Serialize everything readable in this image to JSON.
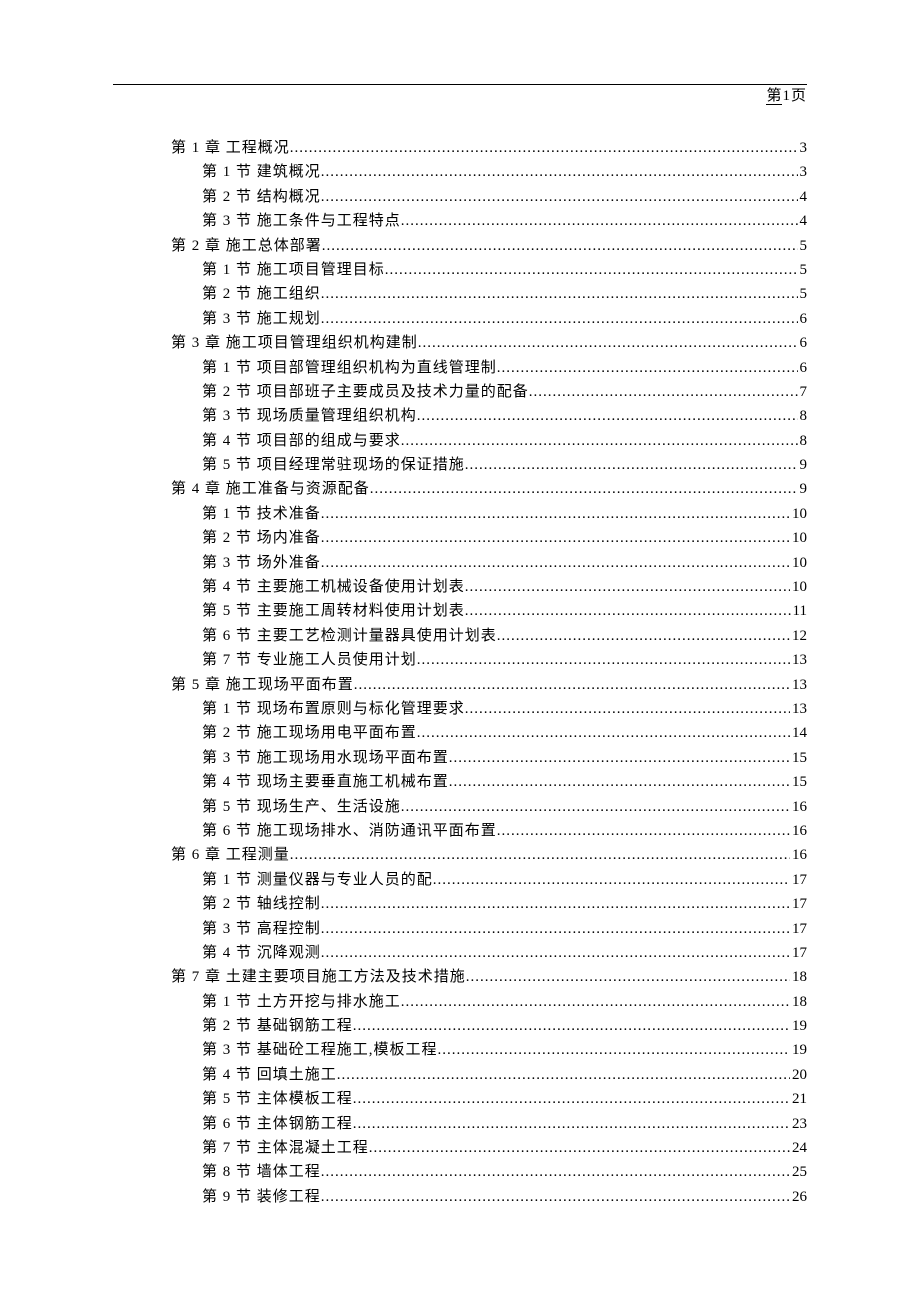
{
  "header": {
    "page_prefix": "第",
    "page_num": "1",
    "page_suffix": "页"
  },
  "toc": [
    {
      "level": 1,
      "title": "第 1 章  工程概况",
      "page": "3"
    },
    {
      "level": 2,
      "title": "第 1 节  建筑概况",
      "page": "3"
    },
    {
      "level": 2,
      "title": "第 2 节  结构概况",
      "page": "4"
    },
    {
      "level": 2,
      "title": "第 3 节  施工条件与工程特点",
      "page": "4"
    },
    {
      "level": 1,
      "title": "第 2 章  施工总体部署",
      "page": "5"
    },
    {
      "level": 2,
      "title": "第 1 节  施工项目管理目标",
      "page": "5"
    },
    {
      "level": 2,
      "title": "第 2 节  施工组织",
      "page": "5"
    },
    {
      "level": 2,
      "title": "第 3 节  施工规划",
      "page": "6"
    },
    {
      "level": 1,
      "title": "第 3 章  施工项目管理组织机构建制",
      "page": "6"
    },
    {
      "level": 2,
      "title": "第 1 节  项目部管理组织机构为直线管理制",
      "page": "6"
    },
    {
      "level": 2,
      "title": "第 2 节  项目部班子主要成员及技术力量的配备",
      "page": "7"
    },
    {
      "level": 2,
      "title": "第 3 节  现场质量管理组织机构",
      "page": "8"
    },
    {
      "level": 2,
      "title": "第 4 节  项目部的组成与要求",
      "page": "8"
    },
    {
      "level": 2,
      "title": "第 5 节  项目经理常驻现场的保证措施",
      "page": "9"
    },
    {
      "level": 1,
      "title": "第 4 章  施工准备与资源配备",
      "page": "9"
    },
    {
      "level": 2,
      "title": "第 1 节  技术准备",
      "page": "10"
    },
    {
      "level": 2,
      "title": "第 2 节  场内准备",
      "page": "10"
    },
    {
      "level": 2,
      "title": "第 3 节  场外准备",
      "page": "10"
    },
    {
      "level": 2,
      "title": "第 4 节  主要施工机械设备使用计划表",
      "page": "10"
    },
    {
      "level": 2,
      "title": "第 5 节  主要施工周转材料使用计划表",
      "page": "11"
    },
    {
      "level": 2,
      "title": "第 6 节  主要工艺检测计量器具使用计划表",
      "page": "12"
    },
    {
      "level": 2,
      "title": "第 7 节  专业施工人员使用计划",
      "page": "13"
    },
    {
      "level": 1,
      "title": "第 5 章  施工现场平面布置",
      "page": "13"
    },
    {
      "level": 2,
      "title": "第 1 节  现场布置原则与标化管理要求",
      "page": "13"
    },
    {
      "level": 2,
      "title": "第 2 节  施工现场用电平面布置",
      "page": "14"
    },
    {
      "level": 2,
      "title": "第 3 节  施工现场用水现场平面布置",
      "page": "15"
    },
    {
      "level": 2,
      "title": "第 4 节  现场主要垂直施工机械布置",
      "page": "15"
    },
    {
      "level": 2,
      "title": "第 5 节  现场生产、生活设施",
      "page": "16"
    },
    {
      "level": 2,
      "title": "第 6 节  施工现场排水、消防通讯平面布置",
      "page": "16"
    },
    {
      "level": 1,
      "title": "第 6 章  工程测量",
      "page": "16"
    },
    {
      "level": 2,
      "title": "第 1 节  测量仪器与专业人员的配",
      "page": "17"
    },
    {
      "level": 2,
      "title": "第 2 节  轴线控制",
      "page": "17"
    },
    {
      "level": 2,
      "title": "第 3 节  高程控制",
      "page": "17"
    },
    {
      "level": 2,
      "title": "第 4 节  沉降观测",
      "page": "17"
    },
    {
      "level": 1,
      "title": "第 7 章  土建主要项目施工方法及技术措施",
      "page": "18"
    },
    {
      "level": 2,
      "title": "第 1 节  土方开挖与排水施工",
      "page": "18"
    },
    {
      "level": 2,
      "title": "第 2 节  基础钢筋工程",
      "page": "19"
    },
    {
      "level": 2,
      "title": "第 3 节  基础砼工程施工,模板工程",
      "page": "19"
    },
    {
      "level": 2,
      "title": "第 4 节  回填土施工",
      "page": "20"
    },
    {
      "level": 2,
      "title": "第 5 节  主体模板工程",
      "page": "21"
    },
    {
      "level": 2,
      "title": "第 6 节  主体钢筋工程",
      "page": "23"
    },
    {
      "level": 2,
      "title": "第 7 节  主体混凝土工程",
      "page": "24"
    },
    {
      "level": 2,
      "title": "第 8 节  墙体工程",
      "page": "25"
    },
    {
      "level": 2,
      "title": "第 9 节  装修工程",
      "page": "26"
    }
  ]
}
